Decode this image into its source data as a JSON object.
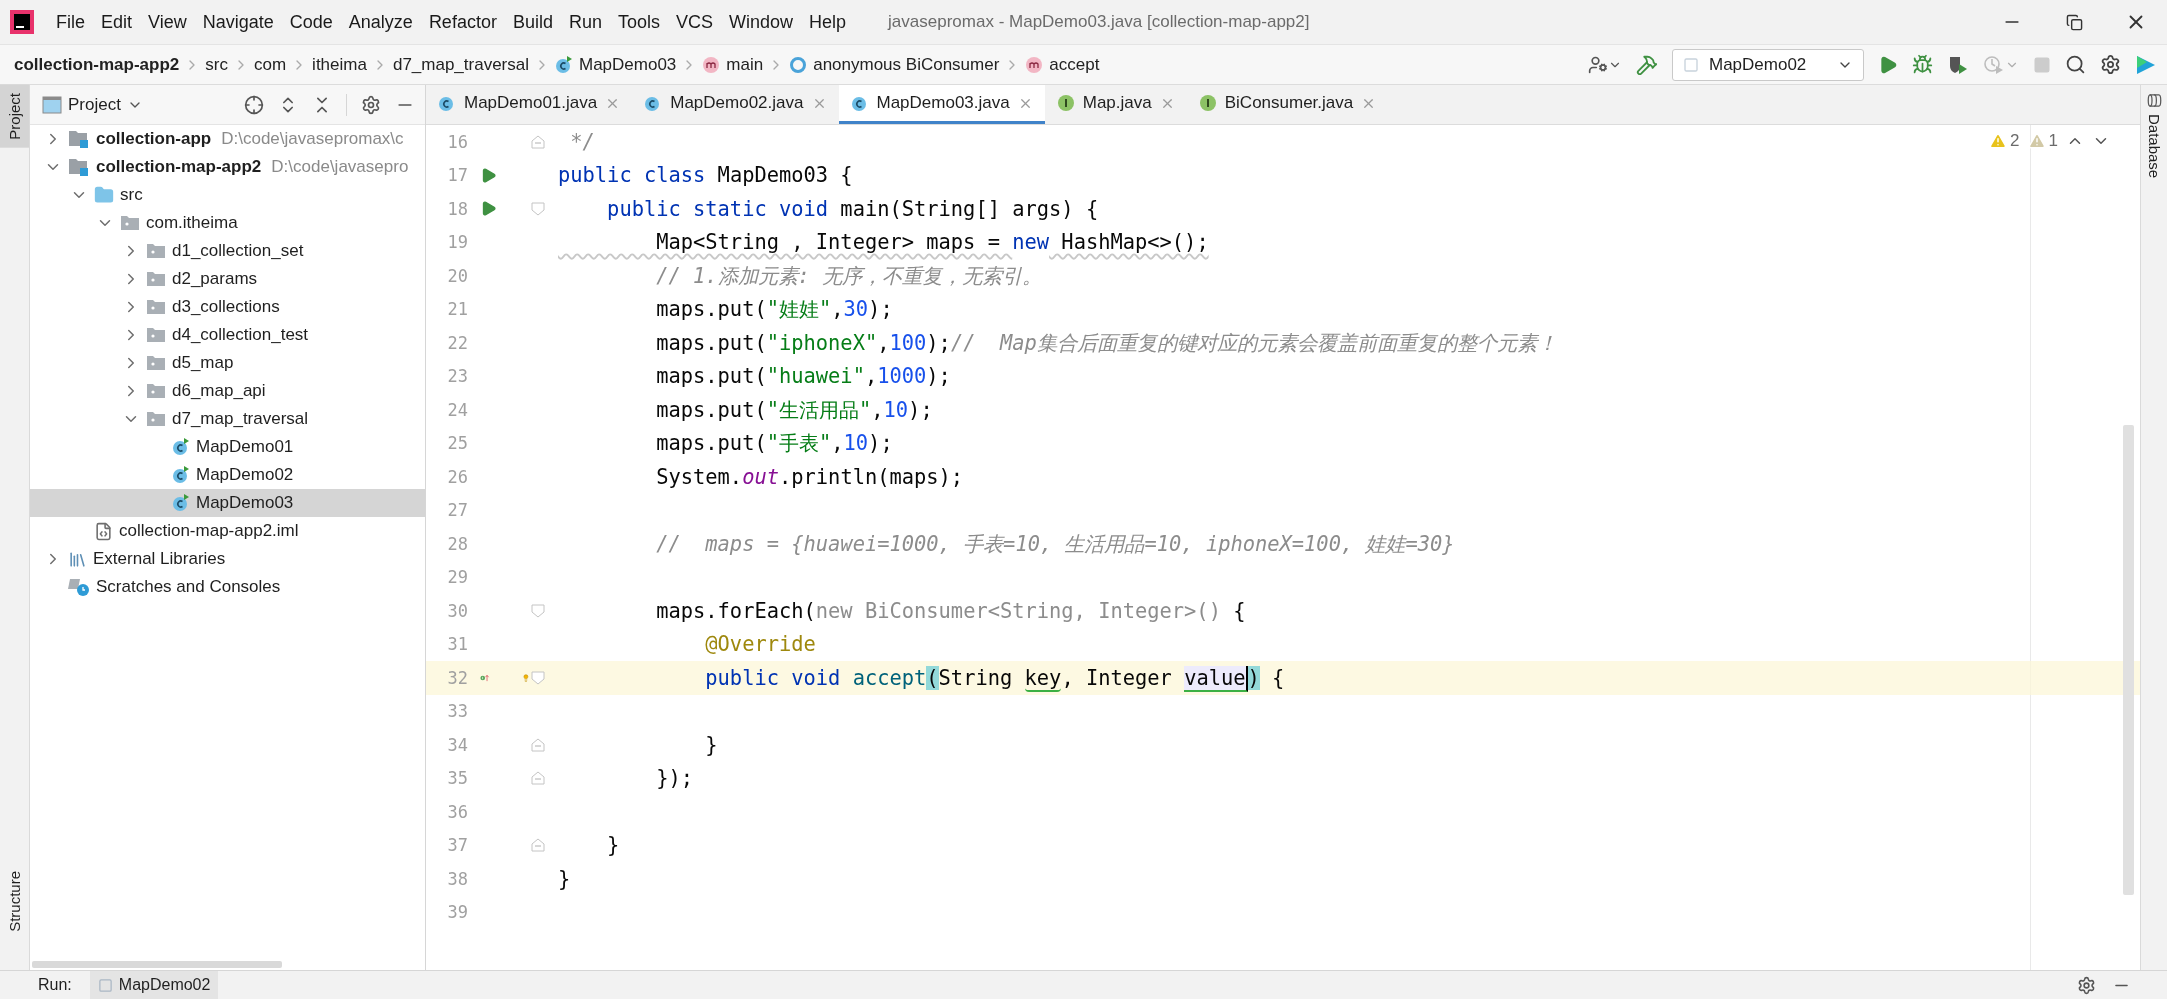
{
  "window": {
    "title": "javasepromax - MapDemo03.java [collection-map-app2]"
  },
  "menu": [
    "File",
    "Edit",
    "View",
    "Navigate",
    "Code",
    "Analyze",
    "Refactor",
    "Build",
    "Run",
    "Tools",
    "VCS",
    "Window",
    "Help"
  ],
  "breadcrumbs": [
    {
      "label": "collection-map-app2",
      "kind": "module"
    },
    {
      "label": "src",
      "kind": "folder"
    },
    {
      "label": "com",
      "kind": "folder"
    },
    {
      "label": "itheima",
      "kind": "folder"
    },
    {
      "label": "d7_map_traversal",
      "kind": "folder"
    },
    {
      "label": "MapDemo03",
      "kind": "class"
    },
    {
      "label": "main",
      "kind": "method"
    },
    {
      "label": "anonymous BiConsumer",
      "kind": "anonymous"
    },
    {
      "label": "accept",
      "kind": "method"
    }
  ],
  "toolbar": {
    "run_config": "MapDemo02",
    "tools": [
      {
        "kind": "user",
        "disabled": false
      },
      {
        "kind": "build",
        "disabled": false
      },
      {
        "kind": "config"
      },
      {
        "kind": "run",
        "disabled": false
      },
      {
        "kind": "debug",
        "disabled": false
      },
      {
        "kind": "coverage",
        "disabled": false
      },
      {
        "kind": "profile",
        "disabled": true
      },
      {
        "kind": "stop",
        "disabled": true
      },
      {
        "kind": "search",
        "disabled": false
      },
      {
        "kind": "settings",
        "disabled": false
      },
      {
        "kind": "logo",
        "disabled": false
      }
    ]
  },
  "left_strip": [
    {
      "label": "Project",
      "selected": true
    },
    {
      "label": "Structure",
      "selected": false
    }
  ],
  "right_strip": [
    {
      "label": "Database",
      "selected": false
    }
  ],
  "project_panel": {
    "title": "Project",
    "tree": [
      {
        "label": "collection-app",
        "hint": "D:\\code\\javasepromax\\c",
        "kind": "module",
        "expanded": false,
        "selected": false
      },
      {
        "label": "collection-map-app2",
        "hint": "D:\\code\\javasepro",
        "kind": "module",
        "expanded": true,
        "selected": false,
        "children": [
          {
            "label": "src",
            "kind": "source",
            "expanded": true,
            "selected": false,
            "children": [
              {
                "label": "com.itheima",
                "kind": "package",
                "expanded": true,
                "selected": false,
                "children": [
                  {
                    "label": "d1_collection_set",
                    "kind": "package",
                    "expanded": false,
                    "selected": false
                  },
                  {
                    "label": "d2_params",
                    "kind": "package",
                    "expanded": false,
                    "selected": false
                  },
                  {
                    "label": "d3_collections",
                    "kind": "package",
                    "expanded": false,
                    "selected": false
                  },
                  {
                    "label": "d4_collection_test",
                    "kind": "package",
                    "expanded": false,
                    "selected": false
                  },
                  {
                    "label": "d5_map",
                    "kind": "package",
                    "expanded": false,
                    "selected": false
                  },
                  {
                    "label": "d6_map_api",
                    "kind": "package",
                    "expanded": false,
                    "selected": false
                  },
                  {
                    "label": "d7_map_traversal",
                    "kind": "package",
                    "expanded": true,
                    "selected": false,
                    "children": [
                      {
                        "label": "MapDemo01",
                        "kind": "class",
                        "selected": false
                      },
                      {
                        "label": "MapDemo02",
                        "kind": "class",
                        "selected": false
                      },
                      {
                        "label": "MapDemo03",
                        "kind": "class",
                        "selected": true
                      }
                    ]
                  }
                ]
              }
            ]
          },
          {
            "label": "collection-map-app2.iml",
            "kind": "iml",
            "selected": false
          }
        ]
      },
      {
        "label": "External Libraries",
        "kind": "libraries",
        "expanded": false,
        "selected": false
      },
      {
        "label": "Scratches and Consoles",
        "kind": "scratches",
        "selected": false
      }
    ]
  },
  "tabs": [
    {
      "label": "MapDemo01.java",
      "kind": "class",
      "selected": false
    },
    {
      "label": "MapDemo02.java",
      "kind": "class",
      "selected": false
    },
    {
      "label": "MapDemo03.java",
      "kind": "class",
      "selected": true
    },
    {
      "label": "Map.java",
      "kind": "interface",
      "selected": false
    },
    {
      "label": "BiConsumer.java",
      "kind": "interface",
      "selected": false
    }
  ],
  "inspections": {
    "warnings": "2",
    "weak_warnings": "1"
  },
  "code": [
    {
      "number": "16",
      "current": false,
      "fold": {
        "kind": "end"
      },
      "tokens": [
        {
          "kind": "comment",
          "text": " */"
        }
      ]
    },
    {
      "number": "17",
      "current": false,
      "gutter": [
        {
          "kind": "run"
        }
      ],
      "tokens": [
        {
          "kind": "keyword",
          "text": "public class"
        },
        {
          "kind": "plain",
          "text": " MapDemo03 {"
        }
      ]
    },
    {
      "number": "18",
      "current": false,
      "gutter": [
        {
          "kind": "run"
        }
      ],
      "fold": {
        "kind": "start"
      },
      "tokens": [
        {
          "kind": "keyword",
          "text": "    public static void"
        },
        {
          "kind": "plain",
          "text": " main(String[] args) {"
        }
      ]
    },
    {
      "number": "19",
      "current": false,
      "tokens": [
        {
          "kind": "warning",
          "text": "        Map<String , Integer> maps = "
        },
        {
          "kind": "keyword",
          "text": "new"
        },
        {
          "kind": "warning",
          "text": " HashMap<>();"
        }
      ]
    },
    {
      "number": "20",
      "current": false,
      "tokens": [
        {
          "kind": "comment",
          "text": "        // 1.添加元素: 无序，不重复，无索引。"
        }
      ]
    },
    {
      "number": "21",
      "current": false,
      "tokens": [
        {
          "kind": "plain",
          "text": "        maps.put("
        },
        {
          "kind": "string",
          "text": "\"娃娃\""
        },
        {
          "kind": "plain",
          "text": ","
        },
        {
          "kind": "number",
          "text": "30"
        },
        {
          "kind": "plain",
          "text": ");"
        }
      ]
    },
    {
      "number": "22",
      "current": false,
      "tokens": [
        {
          "kind": "plain",
          "text": "        maps.put("
        },
        {
          "kind": "string",
          "text": "\"iphoneX\""
        },
        {
          "kind": "plain",
          "text": ","
        },
        {
          "kind": "number",
          "text": "100"
        },
        {
          "kind": "plain",
          "text": ");"
        },
        {
          "kind": "comment",
          "text": "//  Map集合后面重复的键对应的元素会覆盖前面重复的整个元素！"
        }
      ]
    },
    {
      "number": "23",
      "current": false,
      "tokens": [
        {
          "kind": "plain",
          "text": "        maps.put("
        },
        {
          "kind": "string",
          "text": "\"huawei\""
        },
        {
          "kind": "plain",
          "text": ","
        },
        {
          "kind": "number",
          "text": "1000"
        },
        {
          "kind": "plain",
          "text": ");"
        }
      ]
    },
    {
      "number": "24",
      "current": false,
      "tokens": [
        {
          "kind": "plain",
          "text": "        maps.put("
        },
        {
          "kind": "string",
          "text": "\"生活用品\""
        },
        {
          "kind": "plain",
          "text": ","
        },
        {
          "kind": "number",
          "text": "10"
        },
        {
          "kind": "plain",
          "text": ");"
        }
      ]
    },
    {
      "number": "25",
      "current": false,
      "tokens": [
        {
          "kind": "plain",
          "text": "        maps.put("
        },
        {
          "kind": "string",
          "text": "\"手表\""
        },
        {
          "kind": "plain",
          "text": ","
        },
        {
          "kind": "number",
          "text": "10"
        },
        {
          "kind": "plain",
          "text": ");"
        }
      ]
    },
    {
      "number": "26",
      "current": false,
      "tokens": [
        {
          "kind": "plain",
          "text": "        System."
        },
        {
          "kind": "static-field",
          "text": "out"
        },
        {
          "kind": "plain",
          "text": ".println(maps);"
        }
      ]
    },
    {
      "number": "27",
      "current": false
    },
    {
      "number": "28",
      "current": false,
      "tokens": [
        {
          "kind": "comment",
          "text": "        //  maps = {huawei=1000, 手表=10, 生活用品=10, iphoneX=100, 娃娃=30}"
        }
      ]
    },
    {
      "number": "29",
      "current": false
    },
    {
      "number": "30",
      "current": false,
      "fold": {
        "kind": "start"
      },
      "tokens": [
        {
          "kind": "plain",
          "text": "        maps.forEach("
        },
        {
          "kind": "muted",
          "text": "new BiConsumer<String, Integer>()"
        },
        {
          "kind": "plain",
          "text": " {"
        }
      ]
    },
    {
      "number": "31",
      "current": false,
      "tokens": [
        {
          "kind": "annotation",
          "text": "            @Override"
        }
      ]
    },
    {
      "number": "32",
      "current": true,
      "gutter": [
        {
          "kind": "implements"
        },
        {
          "kind": "intention"
        }
      ],
      "fold": {
        "kind": "start"
      },
      "tokens": [
        {
          "kind": "keyword",
          "text": "            public void "
        },
        {
          "kind": "method-decl",
          "text": "accept"
        },
        {
          "kind": "brace-match",
          "text": "("
        },
        {
          "kind": "plain",
          "text": "String "
        },
        {
          "kind": "unused",
          "text": "key"
        },
        {
          "kind": "plain",
          "text": ", Integer "
        },
        {
          "kind": "caret-ident",
          "text": "value"
        },
        {
          "kind": "brace-match",
          "text": ")"
        },
        {
          "kind": "plain",
          "text": " {"
        }
      ]
    },
    {
      "number": "33",
      "current": false
    },
    {
      "number": "34",
      "current": false,
      "fold": {
        "kind": "end"
      },
      "tokens": [
        {
          "kind": "plain",
          "text": "            }"
        }
      ]
    },
    {
      "number": "35",
      "current": false,
      "fold": {
        "kind": "end"
      },
      "tokens": [
        {
          "kind": "plain",
          "text": "        });"
        }
      ]
    },
    {
      "number": "36",
      "current": false
    },
    {
      "number": "37",
      "current": false,
      "fold": {
        "kind": "end"
      },
      "tokens": [
        {
          "kind": "plain",
          "text": "    }"
        }
      ]
    },
    {
      "number": "38",
      "current": false,
      "tokens": [
        {
          "kind": "plain",
          "text": "}"
        }
      ]
    },
    {
      "number": "39",
      "current": false
    }
  ],
  "bottom_bar": {
    "label": "Run:",
    "tabs": [
      {
        "label": "MapDemo02",
        "selected": true
      }
    ]
  }
}
